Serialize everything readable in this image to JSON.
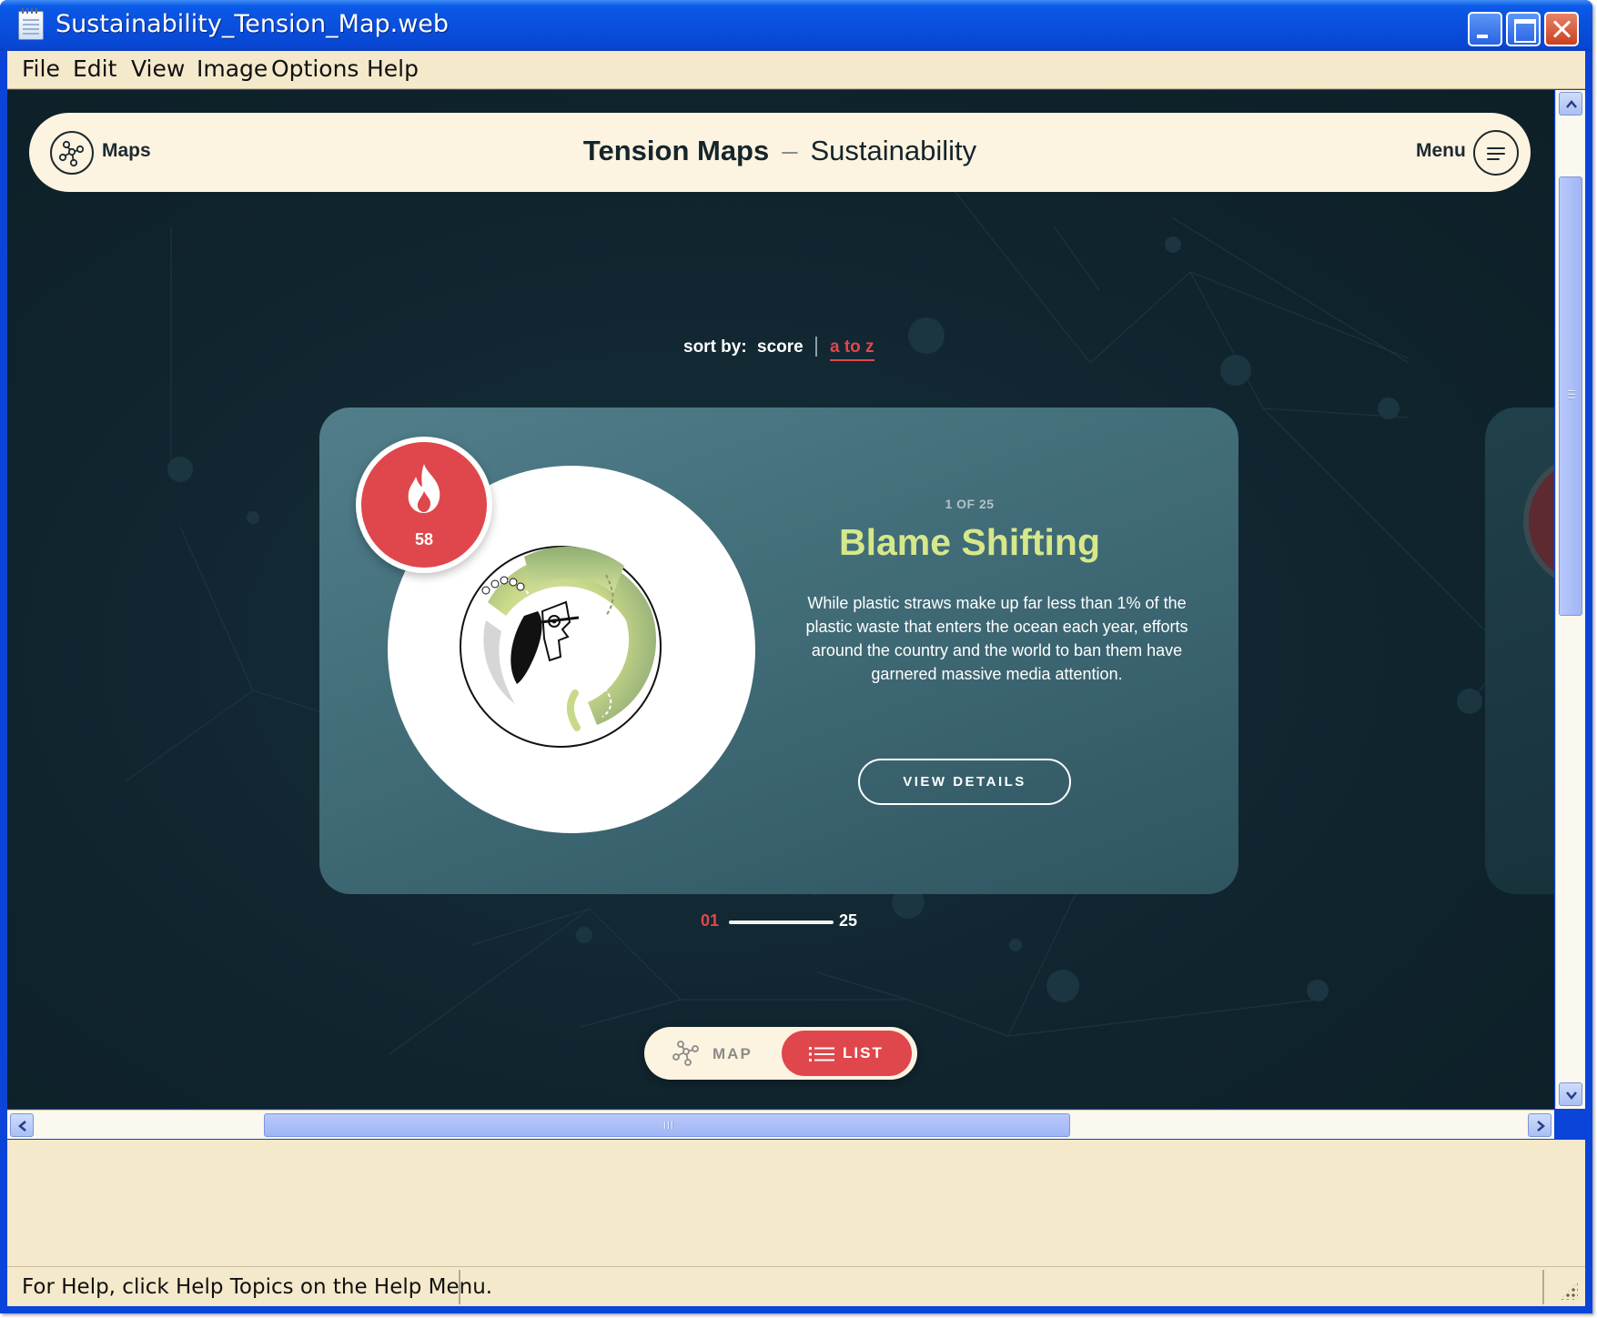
{
  "window": {
    "title": "Sustainability_Tension_Map.web"
  },
  "menubar": {
    "items": [
      "File",
      "Edit",
      "View",
      "Image",
      "Options",
      "Help"
    ]
  },
  "header": {
    "logo_label": "Maps",
    "title_strong": "Tension Maps",
    "title_sep": "–",
    "title_topic": "Sustainability",
    "menu_label": "Menu"
  },
  "sort": {
    "label": "sort by:",
    "options": [
      "score",
      "a to z"
    ],
    "active": "a to z"
  },
  "card": {
    "score": "58",
    "count": "1 OF 25",
    "title": "Blame Shifting",
    "description": "While plastic straws make up far less than 1% of the plastic waste that enters the ocean each year, efforts around the country and the world to ban them have garnered massive media attention.",
    "button": "VIEW DETAILS"
  },
  "pager": {
    "current": "01",
    "total": "25"
  },
  "view_toggle": {
    "map_label": "MAP",
    "list_label": "LIST",
    "active": "LIST"
  },
  "statusbar": {
    "help_text": "For Help, click Help Topics on the Help Menu."
  },
  "colors": {
    "title_bar": "#0a4fde",
    "chrome_bg": "#f5e9cc",
    "page_bg": "#112630",
    "header_bg": "#fcf3e1",
    "card_bg": "#4a7784",
    "accent_red": "#df474c",
    "title_green": "#d6e88a"
  },
  "icons": {
    "logo": "network-nodes-icon",
    "menu": "hamburger-icon",
    "score": "flame-icon",
    "map": "network-nodes-icon",
    "list": "list-icon"
  }
}
